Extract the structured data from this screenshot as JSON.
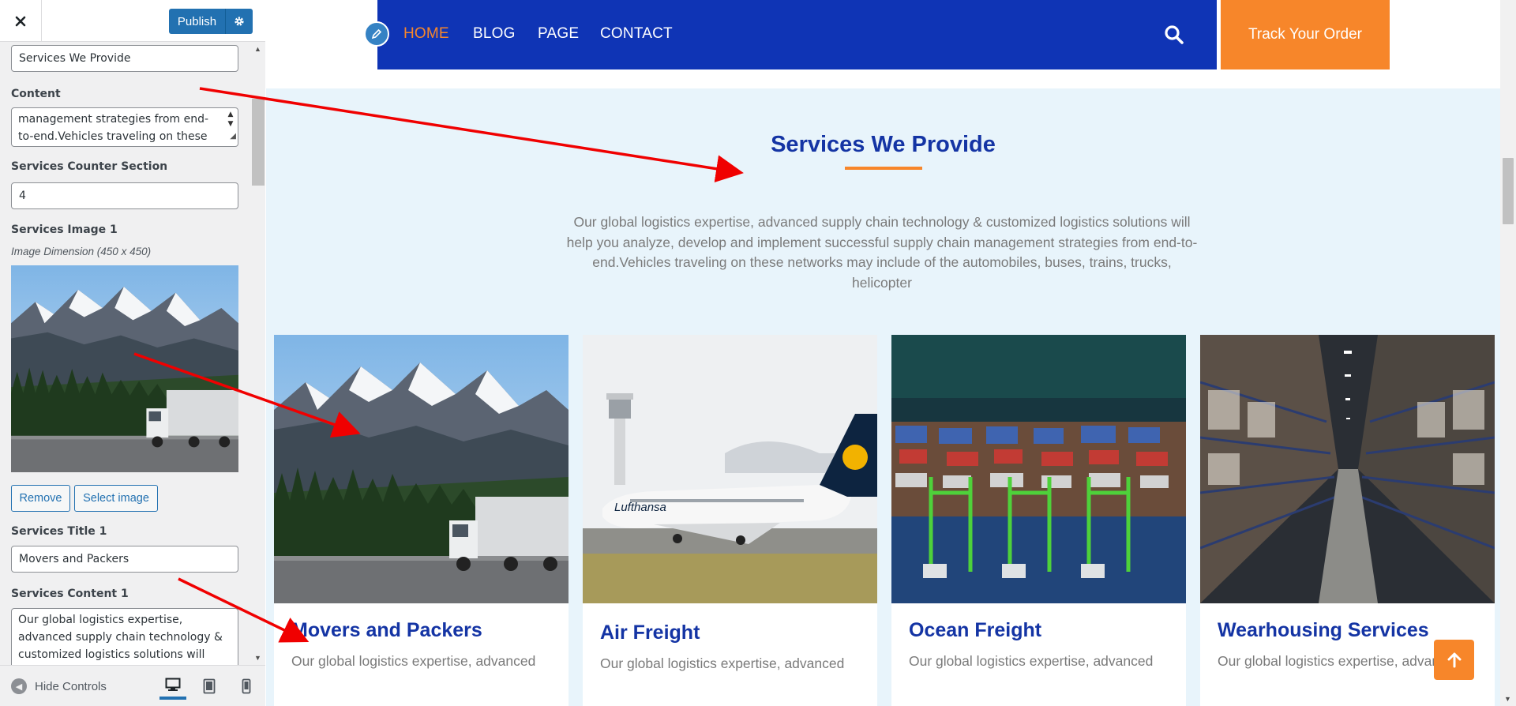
{
  "sidebar": {
    "header": {
      "close_icon": "close-icon",
      "publish_label": "Publish",
      "settings_icon": "gear-icon"
    },
    "fields": {
      "section_title_value": "Services We Provide",
      "content_label": "Content",
      "content_lines": [
        "management strategies from end-",
        "to-end.Vehicles traveling on these"
      ],
      "counter_label": "Services Counter Section",
      "counter_value": "4",
      "image1_label": "Services Image 1",
      "image1_dimension": "Image Dimension (450 x 450)",
      "remove_label": "Remove",
      "select_image_label": "Select image",
      "title1_label": "Services Title 1",
      "title1_value": "Movers and Packers",
      "content1_label": "Services Content 1",
      "content1_lines": [
        "Our global logistics expertise,",
        "advanced supply chain technology &",
        "customized logistics solutions will help"
      ]
    },
    "footer": {
      "hide_controls_label": "Hide Controls",
      "devices": [
        "desktop",
        "tablet",
        "mobile"
      ]
    }
  },
  "preview": {
    "nav": {
      "items": [
        "HOME",
        "BLOG",
        "PAGE",
        "CONTACT"
      ],
      "active": "HOME",
      "search_icon": "search-icon",
      "track_label": "Track Your Order"
    },
    "services": {
      "title": "Services We Provide",
      "description": "Our global logistics expertise, advanced supply chain technology & customized logistics solutions will help you analyze, develop and implement successful supply chain management strategies from end-to-end.Vehicles traveling on these networks may include of the automobiles, buses, trains, trucks, helicopter",
      "cards": [
        {
          "title": "Movers and Packers",
          "text": "Our global logistics expertise, advanced"
        },
        {
          "title": "Air Freight",
          "text": "Our global logistics expertise, advanced"
        },
        {
          "title": "Ocean Freight",
          "text": "Our global logistics expertise, advanced"
        },
        {
          "title": "Wearhousing Services",
          "text": "Our global logistics expertise, advanced"
        }
      ]
    }
  },
  "colors": {
    "nav_blue": "#0f34b5",
    "accent_orange": "#f7862a",
    "title_blue": "#1434a4",
    "section_bg": "#e8f4fb",
    "wp_blue": "#2271b1",
    "annotation_red": "#f00000"
  }
}
